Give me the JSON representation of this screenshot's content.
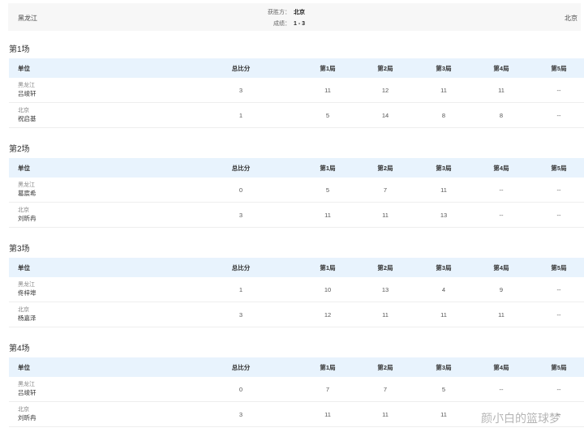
{
  "header": {
    "home_team": "黑龙江",
    "away_team": "北京",
    "winner_label": "获胜方：",
    "winner_value": "北京",
    "score_label": "成绩：",
    "score_value": "1 - 3"
  },
  "columns": [
    "单位",
    "总比分",
    "第1局",
    "第2局",
    "第3局",
    "第4局",
    "第5局"
  ],
  "matches": [
    {
      "title": "第1场",
      "rows": [
        {
          "team": "黑龙江",
          "player": "吕竣轩",
          "values": [
            "3",
            "11",
            "12",
            "11",
            "11",
            "--"
          ]
        },
        {
          "team": "北京",
          "player": "祝启基",
          "values": [
            "1",
            "5",
            "14",
            "8",
            "8",
            "--"
          ]
        }
      ]
    },
    {
      "title": "第2场",
      "rows": [
        {
          "team": "黑龙江",
          "player": "葛宸希",
          "values": [
            "0",
            "5",
            "7",
            "11",
            "--",
            "--"
          ]
        },
        {
          "team": "北京",
          "player": "刘昕冉",
          "values": [
            "3",
            "11",
            "11",
            "13",
            "--",
            "--"
          ]
        }
      ]
    },
    {
      "title": "第3场",
      "rows": [
        {
          "team": "黑龙江",
          "player": "佟梓埠",
          "values": [
            "1",
            "10",
            "13",
            "4",
            "9",
            "--"
          ]
        },
        {
          "team": "北京",
          "player": "杨嘉泽",
          "values": [
            "3",
            "12",
            "11",
            "11",
            "11",
            "--"
          ]
        }
      ]
    },
    {
      "title": "第4场",
      "rows": [
        {
          "team": "黑龙江",
          "player": "吕竣轩",
          "values": [
            "0",
            "7",
            "7",
            "5",
            "--",
            "--"
          ]
        },
        {
          "team": "北京",
          "player": "刘昕冉",
          "values": [
            "3",
            "11",
            "11",
            "11",
            "--",
            "--"
          ]
        }
      ]
    }
  ],
  "watermark": "颜小白的篮球梦"
}
